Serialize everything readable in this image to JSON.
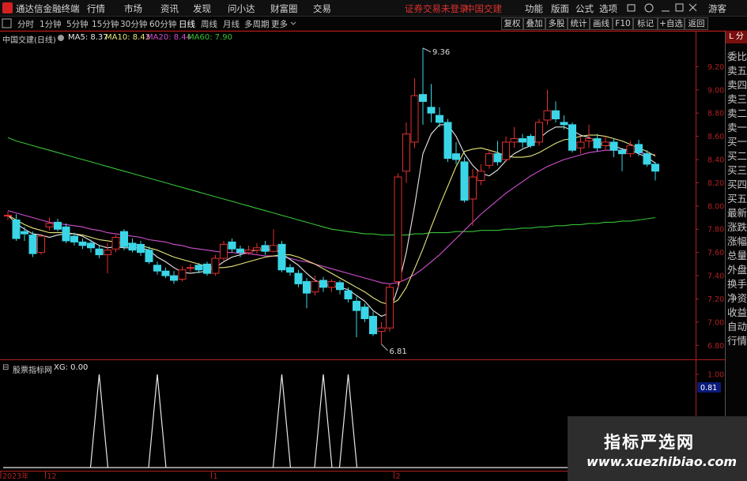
{
  "app": {
    "title": "通达信金融终端",
    "menu": [
      "行情",
      "市场",
      "资讯",
      "发现",
      "问小达",
      "财富圈",
      "交易"
    ],
    "login_status": "证券交易未登录",
    "stock_name_header": "中国交建",
    "right_menu": [
      "功能",
      "版面",
      "公式",
      "选项"
    ],
    "guest": "游客",
    "window_controls": [
      "restore-icon",
      "help-icon",
      "minimize-icon",
      "maximize-icon",
      "close-icon"
    ]
  },
  "toolbar": {
    "periods": [
      "分时",
      "1分钟",
      "5分钟",
      "15分钟",
      "30分钟",
      "60分钟",
      "日线",
      "周线",
      "月线",
      "多周期",
      "更多"
    ],
    "active_period": "日线",
    "right_buttons": [
      "复权",
      "叠加",
      "多股",
      "统计",
      "画线",
      "F10",
      "标记",
      "+自选",
      "返回"
    ]
  },
  "chart_header": {
    "name": "中国交建(日线)",
    "ma": [
      {
        "label": "MA5: 8.37",
        "color": "#e8e8e8"
      },
      {
        "label": "MA10: 8.43",
        "color": "#e8e77a"
      },
      {
        "label": "MA20: 8.44",
        "color": "#d04fd0"
      },
      {
        "label": "MA60: 7.90",
        "color": "#36c236"
      }
    ]
  },
  "indicator_header": {
    "name": "股票指标网",
    "value": "XG: 0.00"
  },
  "sidebar": {
    "tag": "L 分",
    "items": [
      "委比",
      "卖五",
      "卖四",
      "卖三",
      "卖二",
      "卖一",
      "买一",
      "买二",
      "买三",
      "买四",
      "买五",
      "最新",
      "涨跌",
      "涨幅",
      "总量",
      "外盘",
      "换手",
      "净资",
      "收益",
      "自动",
      "行情"
    ]
  },
  "colors": {
    "up": "#e03030",
    "down": "#3ad6e8",
    "ma5": "#e8e8e8",
    "ma10": "#e8e77a",
    "ma20": "#d04fd0",
    "ma60": "#36c236",
    "axis": "#b02020",
    "indicator": "#e8e8e8"
  },
  "chart_data": [
    {
      "type": "candlestick",
      "title": "中国交建(日线)",
      "y_ticks": [
        6.8,
        7.0,
        7.2,
        7.4,
        7.6,
        7.8,
        8.0,
        8.2,
        8.4,
        8.6,
        8.8,
        9.0,
        9.2
      ],
      "ylim": [
        6.7,
        9.42
      ],
      "annotations": [
        {
          "label": "9.36",
          "value": 9.36
        },
        {
          "label": "6.81",
          "value": 6.81
        }
      ],
      "candles": [
        [
          7.92,
          7.92,
          7.95,
          7.88
        ],
        [
          7.88,
          7.72,
          7.93,
          7.7
        ],
        [
          7.78,
          7.76,
          7.82,
          7.7
        ],
        [
          7.75,
          7.59,
          7.78,
          7.56
        ],
        [
          7.6,
          7.74,
          7.76,
          7.58
        ],
        [
          7.82,
          7.85,
          7.9,
          7.79
        ],
        [
          7.86,
          7.8,
          7.89,
          7.78
        ],
        [
          7.82,
          7.7,
          7.85,
          7.68
        ],
        [
          7.74,
          7.69,
          7.77,
          7.66
        ],
        [
          7.69,
          7.66,
          7.72,
          7.63
        ],
        [
          7.68,
          7.64,
          7.71,
          7.6
        ],
        [
          7.63,
          7.58,
          7.66,
          7.55
        ],
        [
          7.58,
          7.62,
          7.68,
          7.42
        ],
        [
          7.63,
          7.73,
          7.75,
          7.6
        ],
        [
          7.78,
          7.65,
          7.8,
          7.62
        ],
        [
          7.68,
          7.62,
          7.72,
          7.6
        ],
        [
          7.67,
          7.6,
          7.7,
          7.57
        ],
        [
          7.62,
          7.52,
          7.65,
          7.5
        ],
        [
          7.49,
          7.44,
          7.52,
          7.41
        ],
        [
          7.44,
          7.4,
          7.47,
          7.38
        ],
        [
          7.4,
          7.36,
          7.44,
          7.33
        ],
        [
          7.37,
          7.45,
          7.48,
          7.35
        ],
        [
          7.47,
          7.47,
          7.5,
          7.43
        ],
        [
          7.49,
          7.45,
          7.51,
          7.42
        ],
        [
          7.5,
          7.42,
          7.52,
          7.4
        ],
        [
          7.42,
          7.55,
          7.58,
          7.4
        ],
        [
          7.55,
          7.67,
          7.7,
          7.52
        ],
        [
          7.69,
          7.63,
          7.72,
          7.6
        ],
        [
          7.63,
          7.6,
          7.66,
          7.56
        ],
        [
          7.6,
          7.62,
          7.66,
          7.58
        ],
        [
          7.62,
          7.64,
          7.68,
          7.59
        ],
        [
          7.66,
          7.61,
          7.7,
          7.58
        ],
        [
          7.61,
          7.66,
          7.8,
          7.6
        ],
        [
          7.67,
          7.45,
          7.7,
          7.43
        ],
        [
          7.47,
          7.43,
          7.5,
          7.4
        ],
        [
          7.42,
          7.33,
          7.45,
          7.3
        ],
        [
          7.35,
          7.25,
          7.38,
          7.12
        ],
        [
          7.26,
          7.35,
          7.4,
          7.23
        ],
        [
          7.36,
          7.3,
          7.39,
          7.26
        ],
        [
          7.3,
          7.35,
          7.37,
          7.26
        ],
        [
          7.34,
          7.28,
          7.36,
          7.24
        ],
        [
          7.27,
          7.2,
          7.3,
          7.17
        ],
        [
          7.18,
          7.1,
          7.22,
          6.87
        ],
        [
          7.13,
          7.03,
          7.16,
          7.0
        ],
        [
          7.05,
          6.9,
          7.09,
          6.88
        ],
        [
          6.92,
          6.95,
          7.0,
          6.81
        ],
        [
          6.95,
          7.3,
          7.33,
          6.92
        ],
        [
          7.35,
          8.25,
          8.28,
          7.3
        ],
        [
          8.3,
          8.62,
          8.72,
          8.2
        ],
        [
          8.55,
          8.95,
          9.1,
          8.5
        ],
        [
          8.96,
          8.9,
          9.36,
          8.7
        ],
        [
          8.85,
          8.8,
          9.05,
          8.72
        ],
        [
          8.78,
          8.72,
          8.85,
          8.68
        ],
        [
          8.72,
          8.41,
          8.75,
          8.38
        ],
        [
          8.45,
          8.4,
          8.55,
          8.36
        ],
        [
          8.38,
          8.05,
          8.42,
          8.03
        ],
        [
          8.06,
          8.25,
          8.32,
          7.83
        ],
        [
          8.22,
          8.3,
          8.36,
          8.18
        ],
        [
          8.35,
          8.45,
          8.48,
          8.32
        ],
        [
          8.45,
          8.38,
          8.56,
          8.35
        ],
        [
          8.4,
          8.55,
          8.6,
          8.38
        ],
        [
          8.55,
          8.58,
          8.68,
          8.5
        ],
        [
          8.58,
          8.55,
          8.62,
          8.5
        ],
        [
          8.6,
          8.52,
          8.62,
          8.5
        ],
        [
          8.55,
          8.72,
          8.75,
          8.52
        ],
        [
          8.74,
          8.82,
          9.0,
          8.7
        ],
        [
          8.82,
          8.75,
          8.9,
          8.72
        ],
        [
          8.72,
          8.7,
          8.78,
          8.66
        ],
        [
          8.7,
          8.48,
          8.72,
          8.46
        ],
        [
          8.5,
          8.55,
          8.6,
          8.45
        ],
        [
          8.56,
          8.58,
          8.7,
          8.5
        ],
        [
          8.58,
          8.5,
          8.62,
          8.47
        ],
        [
          8.52,
          8.55,
          8.6,
          8.48
        ],
        [
          8.55,
          8.48,
          8.58,
          8.42
        ],
        [
          8.48,
          8.45,
          8.5,
          8.3
        ],
        [
          8.45,
          8.52,
          8.56,
          8.42
        ],
        [
          8.53,
          8.46,
          8.57,
          8.43
        ],
        [
          8.45,
          8.36,
          8.48,
          8.34
        ],
        [
          8.36,
          8.3,
          8.38,
          8.22
        ]
      ],
      "ma5": [
        7.92,
        7.85,
        7.8,
        7.76,
        7.75,
        7.73,
        7.75,
        7.76,
        7.76,
        7.74,
        7.7,
        7.66,
        7.64,
        7.65,
        7.64,
        7.64,
        7.64,
        7.62,
        7.56,
        7.52,
        7.47,
        7.43,
        7.42,
        7.43,
        7.44,
        7.47,
        7.52,
        7.56,
        7.58,
        7.61,
        7.62,
        7.62,
        7.63,
        7.59,
        7.54,
        7.49,
        7.42,
        7.36,
        7.33,
        7.31,
        7.3,
        7.28,
        7.23,
        7.18,
        7.1,
        7.05,
        7.08,
        7.3,
        7.6,
        8.0,
        8.45,
        8.62,
        8.7,
        8.7,
        8.6,
        8.45,
        8.35,
        8.28,
        8.26,
        8.31,
        8.39,
        8.45,
        8.49,
        8.52,
        8.58,
        8.64,
        8.68,
        8.68,
        8.65,
        8.61,
        8.59,
        8.55,
        8.52,
        8.52,
        8.49,
        8.48,
        8.45,
        8.42,
        8.37
      ],
      "ma10": [
        7.92,
        7.88,
        7.84,
        7.81,
        7.79,
        7.77,
        7.77,
        7.77,
        7.76,
        7.75,
        7.73,
        7.71,
        7.7,
        7.69,
        7.68,
        7.67,
        7.66,
        7.64,
        7.62,
        7.59,
        7.56,
        7.54,
        7.52,
        7.5,
        7.48,
        7.47,
        7.47,
        7.48,
        7.5,
        7.52,
        7.54,
        7.56,
        7.57,
        7.58,
        7.58,
        7.56,
        7.53,
        7.5,
        7.46,
        7.42,
        7.38,
        7.34,
        7.3,
        7.26,
        7.21,
        7.17,
        7.15,
        7.19,
        7.3,
        7.46,
        7.63,
        7.82,
        8.0,
        8.17,
        8.34,
        8.47,
        8.49,
        8.5,
        8.48,
        8.46,
        8.43,
        8.42,
        8.42,
        8.43,
        8.46,
        8.5,
        8.54,
        8.57,
        8.58,
        8.6,
        8.61,
        8.61,
        8.6,
        8.58,
        8.56,
        8.53,
        8.5,
        8.47,
        8.43
      ],
      "ma20": [
        7.96,
        7.94,
        7.92,
        7.9,
        7.88,
        7.86,
        7.85,
        7.84,
        7.83,
        7.82,
        7.8,
        7.79,
        7.77,
        7.76,
        7.75,
        7.74,
        7.73,
        7.71,
        7.7,
        7.69,
        7.67,
        7.66,
        7.64,
        7.63,
        7.62,
        7.61,
        7.6,
        7.6,
        7.59,
        7.59,
        7.58,
        7.57,
        7.57,
        7.56,
        7.55,
        7.53,
        7.52,
        7.5,
        7.48,
        7.46,
        7.44,
        7.42,
        7.4,
        7.38,
        7.36,
        7.34,
        7.33,
        7.34,
        7.37,
        7.41,
        7.46,
        7.52,
        7.58,
        7.65,
        7.72,
        7.79,
        7.86,
        7.93,
        7.99,
        8.05,
        8.11,
        8.16,
        8.21,
        8.26,
        8.3,
        8.34,
        8.37,
        8.4,
        8.42,
        8.44,
        8.46,
        8.47,
        8.48,
        8.48,
        8.48,
        8.47,
        8.46,
        8.45,
        8.44
      ],
      "ma60": [
        8.59,
        8.56,
        8.54,
        8.52,
        8.5,
        8.48,
        8.46,
        8.44,
        8.42,
        8.4,
        8.38,
        8.36,
        8.34,
        8.32,
        8.3,
        8.28,
        8.26,
        8.24,
        8.22,
        8.2,
        8.18,
        8.16,
        8.14,
        8.12,
        8.1,
        8.08,
        8.06,
        8.04,
        8.02,
        8.0,
        7.98,
        7.96,
        7.94,
        7.92,
        7.9,
        7.88,
        7.86,
        7.84,
        7.82,
        7.8,
        7.79,
        7.78,
        7.77,
        7.76,
        7.76,
        7.75,
        7.75,
        7.75,
        7.75,
        7.76,
        7.76,
        7.77,
        7.77,
        7.77,
        7.78,
        7.78,
        7.78,
        7.79,
        7.79,
        7.79,
        7.8,
        7.8,
        7.81,
        7.81,
        7.82,
        7.82,
        7.83,
        7.83,
        7.84,
        7.84,
        7.85,
        7.85,
        7.86,
        7.86,
        7.87,
        7.87,
        7.88,
        7.89,
        7.9
      ]
    },
    {
      "type": "line",
      "title": "股票指标网",
      "series_name": "XG",
      "y_ticks": [
        1.0,
        0.5
      ],
      "current_value_label": "0.81",
      "ylim": [
        0,
        1.05
      ],
      "signal_indices": [
        11,
        18,
        33,
        38,
        41
      ],
      "x_labels": [
        "2023年",
        "12",
        "1",
        "2"
      ],
      "x_label_indices": [
        0,
        5,
        25,
        47
      ]
    }
  ],
  "watermark": {
    "line1": "指标严选网",
    "line2": "www.xuezhibiao.com"
  }
}
